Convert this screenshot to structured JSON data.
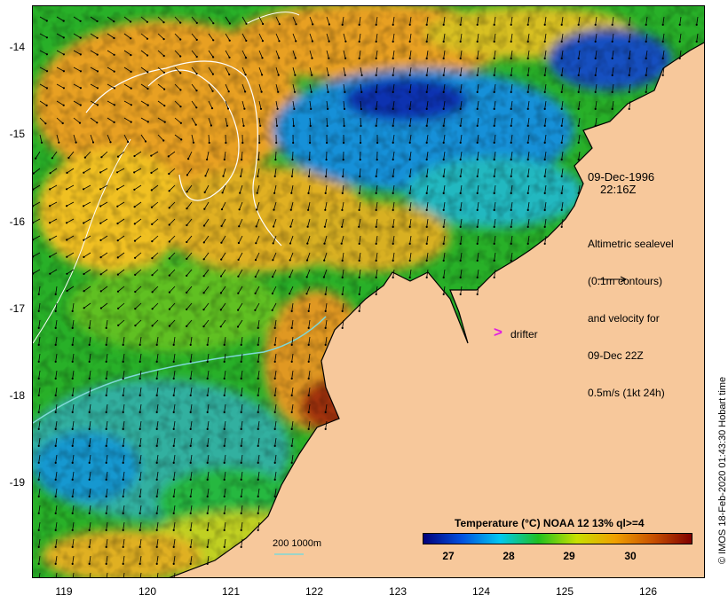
{
  "map": {
    "date": "09-Dec-1996",
    "time": "22:16Z",
    "altimetry_legend": [
      "Altimetric sealevel",
      "(0.1m contours)",
      "and velocity for",
      "09-Dec 22Z",
      "0.5m/s (1kt 24h)"
    ],
    "drifter_label": "drifter",
    "scale_label": "200  1000m",
    "credit": "© IMOS 18-Feb-2020 01:43:30 Hobart time",
    "lat_ticks": [
      "-14",
      "-15",
      "-16",
      "-17",
      "-18",
      "-19"
    ],
    "lon_ticks": [
      "119",
      "120",
      "121",
      "122",
      "123",
      "124",
      "125",
      "126"
    ],
    "colors": {
      "land": "#f7c89b",
      "arrow": "#000000",
      "drifter": "#e020e0"
    }
  },
  "colorbar": {
    "title": "Temperature (°C) NOAA 12 13% ql>=4",
    "ticks": [
      "27",
      "28",
      "29",
      "30"
    ],
    "stops": [
      "#00007a",
      "#0050e0",
      "#00c8f0",
      "#20c020",
      "#c8e000",
      "#f0a000",
      "#c85000",
      "#800000"
    ]
  }
}
